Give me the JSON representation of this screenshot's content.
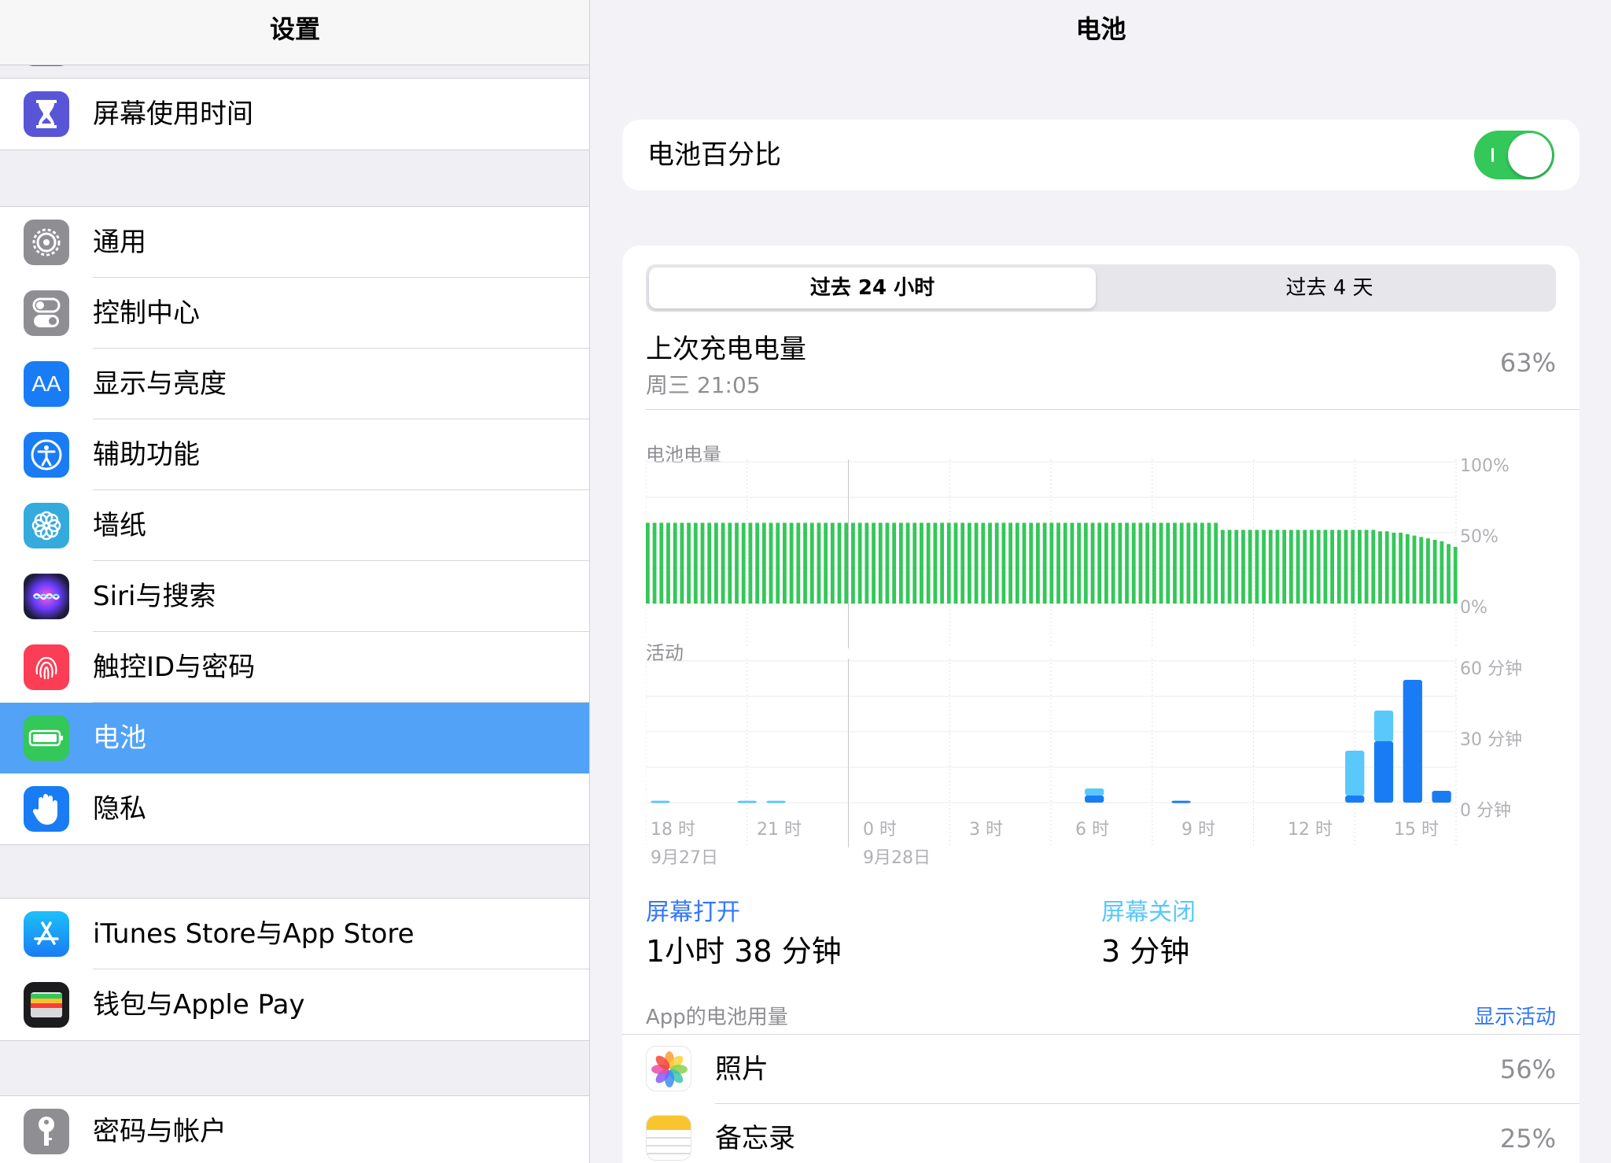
{
  "sidebar": {
    "title": "设置",
    "groups": [
      {
        "items": [
          {
            "label": "屏幕使用时间",
            "icon": "hourglass-icon",
            "color": "#5856d6"
          }
        ]
      },
      {
        "items": [
          {
            "label": "通用",
            "icon": "gear-icon",
            "color": "#8e8e93"
          },
          {
            "label": "控制中心",
            "icon": "toggles-icon",
            "color": "#8e8e93"
          },
          {
            "label": "显示与亮度",
            "icon": "text-size-icon",
            "color": "#1a7cf5"
          },
          {
            "label": "辅助功能",
            "icon": "accessibility-icon",
            "color": "#1a7cf5"
          },
          {
            "label": "墙纸",
            "icon": "flower-icon",
            "color": "#35aadc"
          },
          {
            "label": "Siri与搜索",
            "icon": "siri-icon",
            "color": "#1c1c3a"
          },
          {
            "label": "触控ID与密码",
            "icon": "fingerprint-icon",
            "color": "#fc3d56"
          },
          {
            "label": "电池",
            "icon": "battery-icon",
            "color": "#34c759",
            "selected": true
          },
          {
            "label": "隐私",
            "icon": "hand-icon",
            "color": "#1a7cf5"
          }
        ]
      },
      {
        "items": [
          {
            "label": "iTunes Store与App Store",
            "icon": "app-store-icon",
            "color": "#1a8cf5"
          },
          {
            "label": "钱包与Apple Pay",
            "icon": "wallet-icon",
            "color": "#1c1c1e"
          }
        ]
      },
      {
        "items": [
          {
            "label": "密码与帐户",
            "icon": "key-icon",
            "color": "#8e8e93"
          }
        ]
      }
    ]
  },
  "main": {
    "title": "电池",
    "battery_percentage": {
      "label": "电池百分比",
      "on": true
    },
    "tabs": [
      {
        "label": "过去 24 小时",
        "active": true
      },
      {
        "label": "过去 4 天",
        "active": false
      }
    ],
    "last_charge": {
      "label": "上次充电电量",
      "time": "周三 21:05",
      "value": "63%"
    },
    "screen_on": {
      "label": "屏幕打开",
      "value": "1小时 38 分钟"
    },
    "screen_off": {
      "label": "屏幕关闭",
      "value": "3 分钟"
    },
    "usage": {
      "header": "App的电池用量",
      "action": "显示活动",
      "apps": [
        {
          "name": "照片",
          "pct": "56%",
          "icon": "photos-icon"
        },
        {
          "name": "备忘录",
          "pct": "25%",
          "icon": "notes-icon"
        }
      ]
    }
  },
  "chart_data": [
    {
      "type": "bar",
      "title": "电池电量",
      "y_ticks": [
        "100%",
        "50%",
        "0%"
      ],
      "ylim": [
        0,
        100
      ],
      "grid": true,
      "color": "#34c759",
      "values": [
        57,
        57,
        57,
        57,
        57,
        57,
        57,
        57,
        57,
        57,
        57,
        57,
        57,
        57,
        57,
        57,
        57,
        57,
        57,
        57,
        57,
        57,
        57,
        57,
        57,
        57,
        57,
        57,
        57,
        57,
        57,
        57,
        57,
        57,
        57,
        57,
        57,
        57,
        57,
        57,
        57,
        57,
        57,
        57,
        57,
        57,
        57,
        57,
        57,
        57,
        57,
        57,
        57,
        57,
        57,
        57,
        57,
        57,
        57,
        57,
        57,
        57,
        57,
        57,
        57,
        57,
        57,
        57,
        57,
        57,
        57,
        57,
        57,
        57,
        57,
        57,
        57,
        57,
        57,
        57,
        57,
        57,
        57,
        57,
        52,
        52,
        52,
        52,
        52,
        52,
        52,
        52,
        52,
        52,
        52,
        52,
        52,
        52,
        52,
        52,
        52,
        52,
        52,
        52,
        52,
        52,
        52,
        51,
        51,
        50,
        50,
        49,
        48,
        47,
        46,
        45,
        44,
        42,
        40
      ]
    },
    {
      "type": "bar",
      "title": "活动",
      "y_ticks": [
        "60 分钟",
        "30 分钟",
        "0 分钟"
      ],
      "ylim": [
        0,
        60
      ],
      "grid": true,
      "x_ticks": [
        "18 时",
        "21 时",
        "0 时",
        "3 时",
        "6 时",
        "9 时",
        "12 时",
        "15 时"
      ],
      "x_dates": [
        "9月27日",
        "9月28日"
      ],
      "series": [
        {
          "name": "屏幕打开",
          "color": "#1a7cf5",
          "values": [
            0,
            0,
            0,
            0,
            0,
            0,
            0,
            0,
            0,
            0,
            0,
            0,
            0,
            0,
            0,
            3,
            0,
            0,
            0.8,
            0,
            0,
            0,
            0,
            0,
            3,
            26,
            52,
            5
          ]
        },
        {
          "name": "屏幕关闭",
          "color": "#5ac8fa",
          "values": [
            0.8,
            0,
            0,
            0.8,
            0.8,
            0,
            0,
            0,
            0,
            0,
            0,
            0,
            0,
            0,
            0,
            3,
            0,
            0,
            0,
            0,
            0,
            0,
            0,
            0,
            19,
            13,
            0,
            0
          ]
        }
      ]
    }
  ]
}
